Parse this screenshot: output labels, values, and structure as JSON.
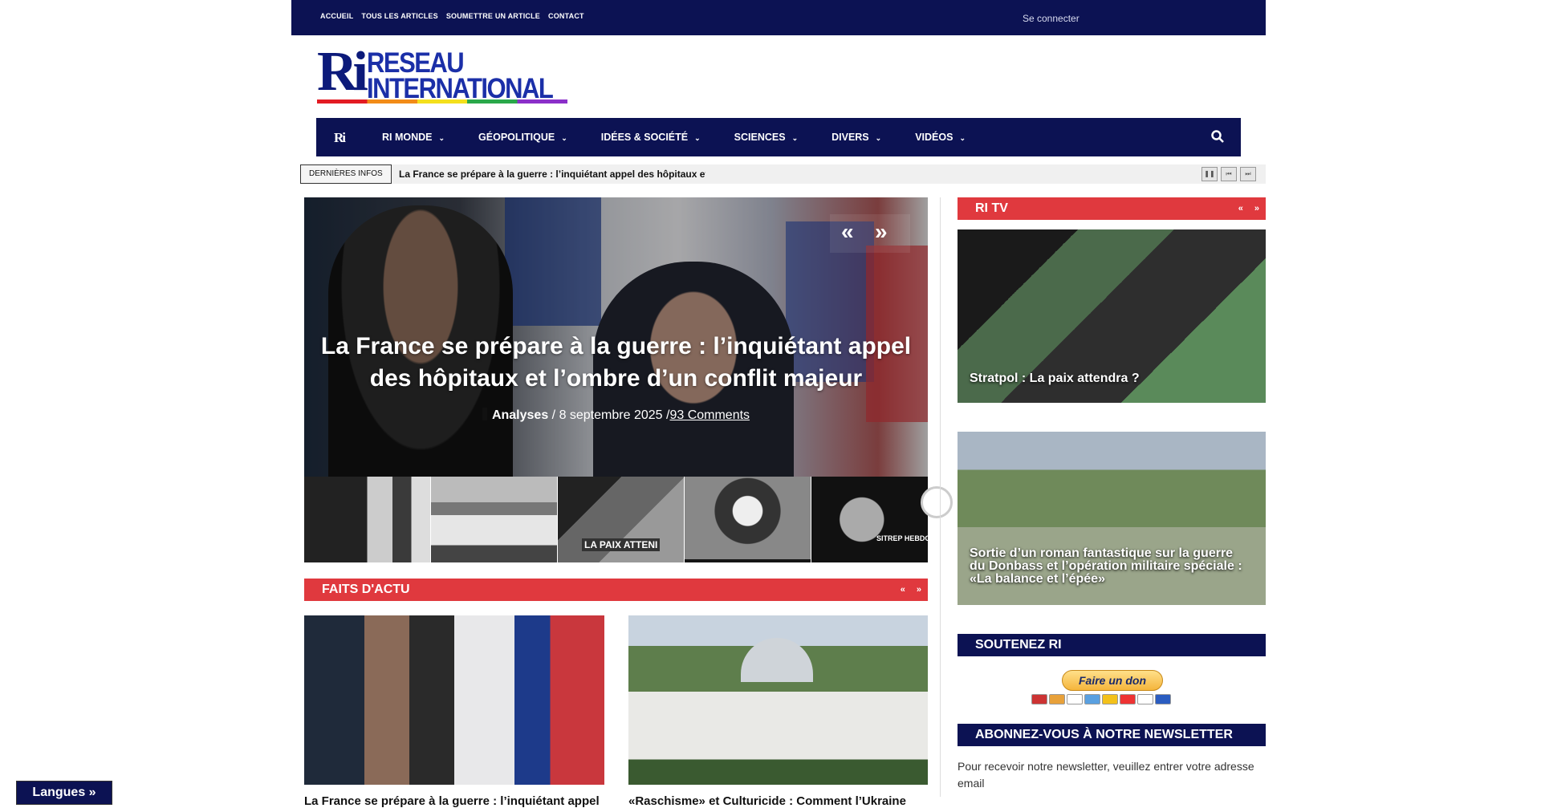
{
  "topbar": {
    "nav": [
      "ACCUEIL",
      "TOUS LES ARTICLES",
      "SOUMETTRE UN ARTICLE",
      "CONTACT"
    ],
    "login": "Se connecter"
  },
  "logo": {
    "mark": "Ri",
    "line1": "RESEAU",
    "line2": "INTERNATIONAL"
  },
  "mainnav": {
    "home": "Ri",
    "items": [
      "RI MONDE",
      "GÉOPOLITIQUE",
      "IDÉES & SOCIÉTÉ",
      "SCIENCES",
      "DIVERS",
      "VIDÉOS"
    ],
    "chevron": "⌄"
  },
  "ticker": {
    "label": "DERNIÈRES INFOS",
    "text": "La France se prépare à la guerre : l’inquiétant appel des hôpitaux et l’ombre d’un conflit majeur",
    "controls": [
      "❚❚",
      "⏮",
      "⏭"
    ]
  },
  "slider": {
    "title": "La France se prépare à la guerre : l’inquiétant appel des hôpitaux et l’ombre d’un conflit majeur",
    "category": "Analyses",
    "date": "/ 8 septembre 2025",
    "separator": "/",
    "comments": "93 Comments",
    "prev": "«",
    "next": "»",
    "thumb_captions": [
      "",
      "",
      "LA PAIX ATTENI",
      "",
      "SITREP HEBDO"
    ]
  },
  "faits": {
    "title": "FAITS D'ACTU",
    "prev": "«",
    "next": "»"
  },
  "articles": [
    {
      "title": "La France se prépare à la guerre : l’inquiétant appel"
    },
    {
      "title": "«Raschisme» et Culturicide : Comment l’Ukraine"
    }
  ],
  "sidebar": {
    "ritv": {
      "title": "RI TV",
      "prev": "«",
      "next": "»"
    },
    "videos": [
      {
        "caption": "Stratpol : La paix attendra ?"
      },
      {
        "caption": "Sortie d’un roman fantastique sur la guerre du Donbass et l’opération militaire spéciale : «La balance et l’épée»"
      }
    ],
    "soutenez": {
      "title": "SOUTENEZ RI",
      "button": "Faire un don"
    },
    "newsletter": {
      "title": "ABONNEZ-VOUS À NOTRE NEWSLETTER",
      "text": "Pour recevoir notre newsletter, veuillez entrer votre adresse email"
    }
  },
  "langues": "Langues »",
  "colors": {
    "navy": "#0c1253",
    "red": "#e0393e"
  }
}
